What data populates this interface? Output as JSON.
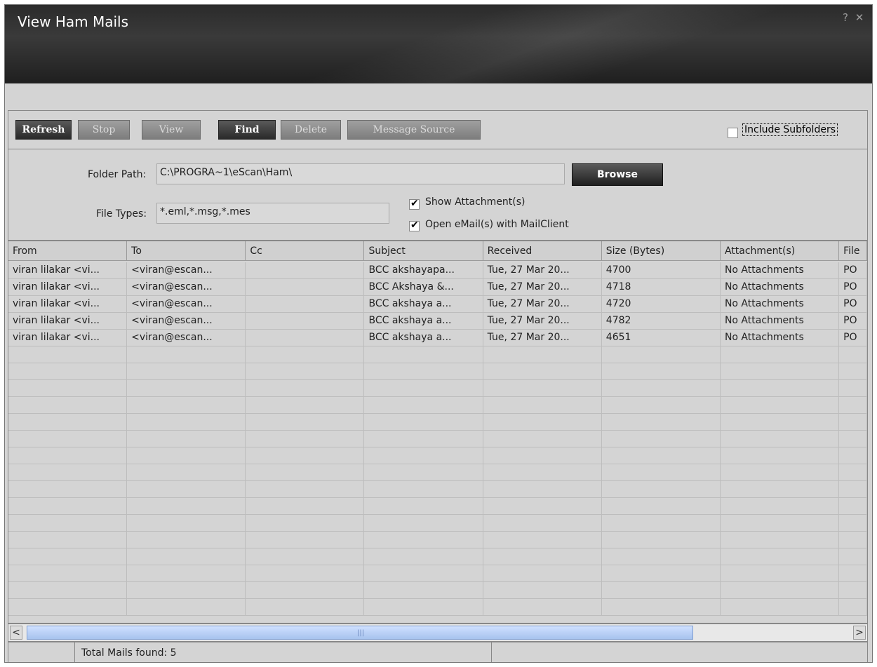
{
  "window": {
    "title": "View Ham Mails",
    "help": "?",
    "close": "✕"
  },
  "toolbar": {
    "refresh": "Refresh",
    "stop": "Stop",
    "view": "View",
    "find": "Find",
    "delete": "Delete",
    "message_source": "Message Source",
    "include_subfolders": "Include Subfolders",
    "include_subfolders_checked": false
  },
  "options": {
    "folder_path_label": "Folder Path:",
    "folder_path_value": "C:\\PROGRA~1\\eScan\\Ham\\",
    "browse": "Browse",
    "file_types_label": "File Types:",
    "file_types_value": "*.eml,*.msg,*.mes",
    "show_attachments": "Show Attachment(s)",
    "show_attachments_checked": true,
    "open_with_mailclient": "Open eMail(s) with MailClient",
    "open_with_mailclient_checked": true
  },
  "table": {
    "columns": [
      "From",
      "To",
      "Cc",
      "Subject",
      "Received",
      "Size (Bytes)",
      "Attachment(s)",
      "File"
    ],
    "rows": [
      [
        "viran lilakar <vi...",
        "<viran@escan...",
        "",
        "BCC akshayapa...",
        "Tue, 27 Mar 20...",
        "4700",
        "No Attachments",
        "PO"
      ],
      [
        "viran lilakar <vi...",
        "<viran@escan...",
        "",
        "BCC Akshaya &...",
        "Tue, 27 Mar 20...",
        "4718",
        "No Attachments",
        "PO"
      ],
      [
        "viran lilakar <vi...",
        "<viran@escan...",
        "",
        "BCC akshaya a...",
        "Tue, 27 Mar 20...",
        "4720",
        "No Attachments",
        "PO"
      ],
      [
        "viran lilakar <vi...",
        "<viran@escan...",
        "",
        "BCC akshaya a...",
        "Tue, 27 Mar 20...",
        "4782",
        "No Attachments",
        "PO"
      ],
      [
        "viran lilakar <vi...",
        "<viran@escan...",
        "",
        "BCC akshaya a...",
        "Tue, 27 Mar 20...",
        "4651",
        "No Attachments",
        "PO"
      ]
    ]
  },
  "scrollbar": {
    "left": "<",
    "right": ">",
    "grip": "|||"
  },
  "status": {
    "total": "Total Mails found: 5"
  }
}
